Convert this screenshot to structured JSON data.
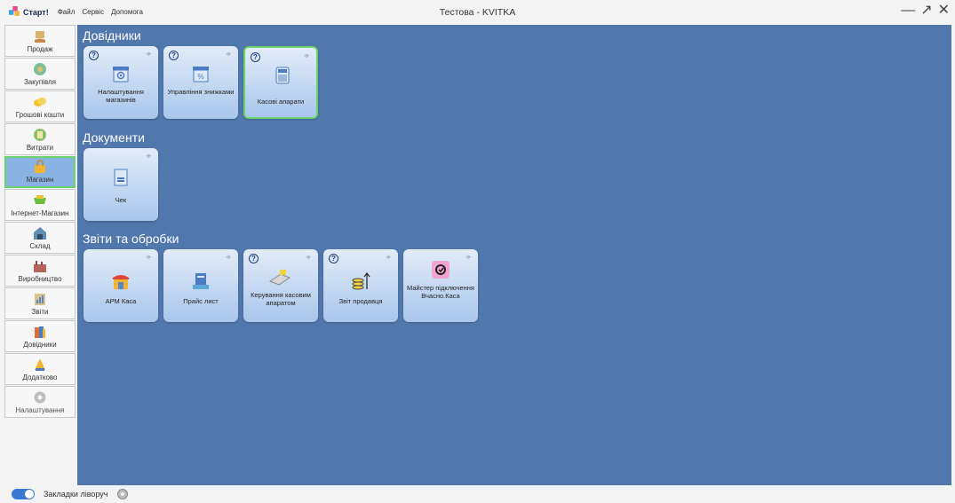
{
  "app": {
    "brand": "Старт!",
    "menu": [
      "Файл",
      "Сервіс",
      "Допомога"
    ],
    "window_title": "Тестова - KVITKA",
    "window_controls": {
      "minimize": "—",
      "restore": "↗",
      "close": "✕"
    }
  },
  "sidebar": {
    "items": [
      {
        "label": "Продаж",
        "icon": "cash-hand-icon"
      },
      {
        "label": "Закупівля",
        "icon": "purchase-icon"
      },
      {
        "label": "Грошові кошти",
        "icon": "coins-icon"
      },
      {
        "label": "Витрати",
        "icon": "expenses-icon"
      },
      {
        "label": "Магазин",
        "icon": "shop-bag-icon",
        "active": true
      },
      {
        "label": "Інтернет-Магазин",
        "icon": "cart-icon"
      },
      {
        "label": "Склад",
        "icon": "warehouse-icon"
      },
      {
        "label": "Виробництво",
        "icon": "factory-icon"
      },
      {
        "label": "Звіти",
        "icon": "reports-icon"
      },
      {
        "label": "Довідники",
        "icon": "books-icon"
      },
      {
        "label": "Додатково",
        "icon": "extra-icon"
      },
      {
        "label": "Налаштування",
        "icon": "settings-gear-icon"
      }
    ]
  },
  "sections": {
    "references": {
      "title": "Довідники",
      "tiles": [
        {
          "label": "Налаштування магазинів",
          "icon": "store-settings-icon",
          "help": "?"
        },
        {
          "label": "Управління знижками",
          "icon": "discount-store-icon",
          "help": "?"
        },
        {
          "label": "Касові апарати",
          "icon": "cash-register-icon",
          "help": "?",
          "selected": true
        }
      ]
    },
    "documents": {
      "title": "Документи",
      "tiles": [
        {
          "label": "Чек",
          "icon": "receipt-icon"
        }
      ]
    },
    "reports": {
      "title": "Звіти та обробки",
      "tiles": [
        {
          "label": "АРМ Каса",
          "icon": "storefront-icon"
        },
        {
          "label": "Прайс лист",
          "icon": "price-list-icon"
        },
        {
          "label": "Керування касовим апаратом",
          "icon": "pos-terminal-icon",
          "help": "?"
        },
        {
          "label": "Звіт продавця",
          "icon": "coins-stack-icon",
          "help": "?"
        },
        {
          "label": "Майстер підключення Вчасно.Каса",
          "icon": "vchasno-kasa-icon"
        }
      ]
    }
  },
  "pin_glyph": "⌖",
  "status": {
    "toggle_label": "Закладки ліворуч"
  },
  "colors": {
    "main_bg": "#5178ad",
    "active_item": "#89b3e2",
    "selection_border": "#6bd36b",
    "toggle": "#3a79d3"
  }
}
